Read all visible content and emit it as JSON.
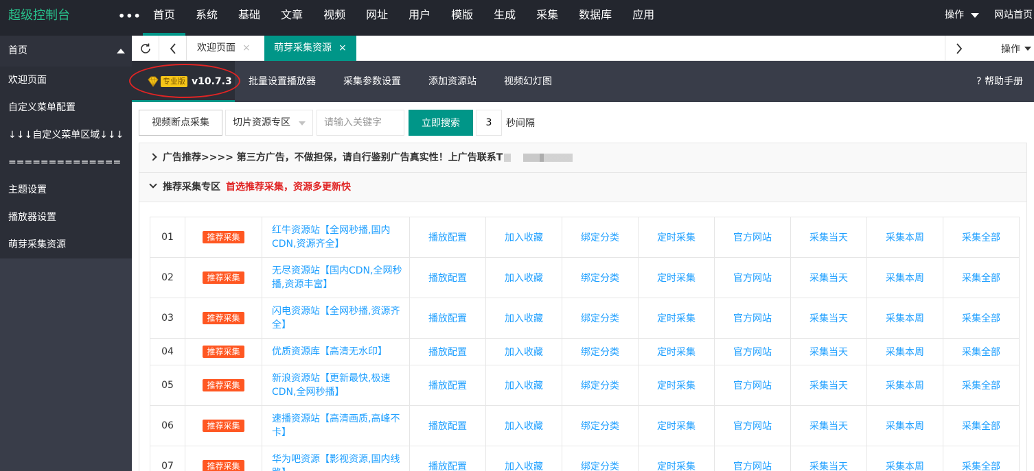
{
  "app": {
    "title": "超级控制台",
    "more": "•••"
  },
  "topnav": [
    "首页",
    "系统",
    "基础",
    "文章",
    "视频",
    "网址",
    "用户",
    "模版",
    "生成",
    "采集",
    "数据库",
    "应用"
  ],
  "topright": {
    "operate": "操作",
    "site_home": "网站首页"
  },
  "sidebar": {
    "header": "首页",
    "items": [
      "欢迎页面",
      "自定义菜单配置",
      "↓↓↓自定义菜单区域↓↓↓",
      "==============",
      "主题设置",
      "播放器设置",
      "萌芽采集资源"
    ]
  },
  "tabs": {
    "items": [
      {
        "label": "欢迎页面",
        "close": "×"
      },
      {
        "label": "萌芽采集资源",
        "close": "×"
      }
    ],
    "operate": "操作"
  },
  "subnav": {
    "badge": "专业版",
    "version": "v10.7.3",
    "items": [
      "批量设置播放器",
      "采集参数设置",
      "添加资源站",
      "视频幻灯图"
    ],
    "help": "? 帮助手册"
  },
  "toolbar": {
    "breakpoint_button": "视频断点采集",
    "select_value": "切片资源专区",
    "search_placeholder": "请输入关键字",
    "search_button": "立即搜索",
    "interval_value": "3",
    "interval_unit": "秒间隔"
  },
  "ad": {
    "label": "广告推荐>>>>  第三方广告，不做担保，请自行鉴别广告真实性！上广告联系T"
  },
  "recommend": {
    "title": "推荐采集专区",
    "subtitle": "首选推荐采集，资源多更新快"
  },
  "actions": [
    "播放配置",
    "加入收藏",
    "绑定分类",
    "定时采集",
    "官方网站",
    "采集当天",
    "采集本周",
    "采集全部"
  ],
  "resources": [
    {
      "no": "01",
      "badge": "推荐采集",
      "name": "红牛资源站【全网秒播,国内CDN,资源齐全】"
    },
    {
      "no": "02",
      "badge": "推荐采集",
      "name": "无尽资源站【国内CDN,全网秒播,资源丰富】"
    },
    {
      "no": "03",
      "badge": "推荐采集",
      "name": "闪电资源站【全网秒播,资源齐全】"
    },
    {
      "no": "04",
      "badge": "推荐采集",
      "name": "优质资源库【高清无水印】"
    },
    {
      "no": "05",
      "badge": "推荐采集",
      "name": "新浪资源站【更新最快,极速CDN,全网秒播】"
    },
    {
      "no": "06",
      "badge": "推荐采集",
      "name": "速播资源站【高清画质,高峰不卡】"
    },
    {
      "no": "07",
      "badge": "推荐采集",
      "name": "华为吧资源【影视资源,国内线路】"
    }
  ],
  "colors": {
    "accent": "#009688",
    "dark": "#23262e",
    "sidebar": "#393d49",
    "link": "#1e9fff",
    "badge": "#ff5722",
    "highlight": "#e02424"
  }
}
